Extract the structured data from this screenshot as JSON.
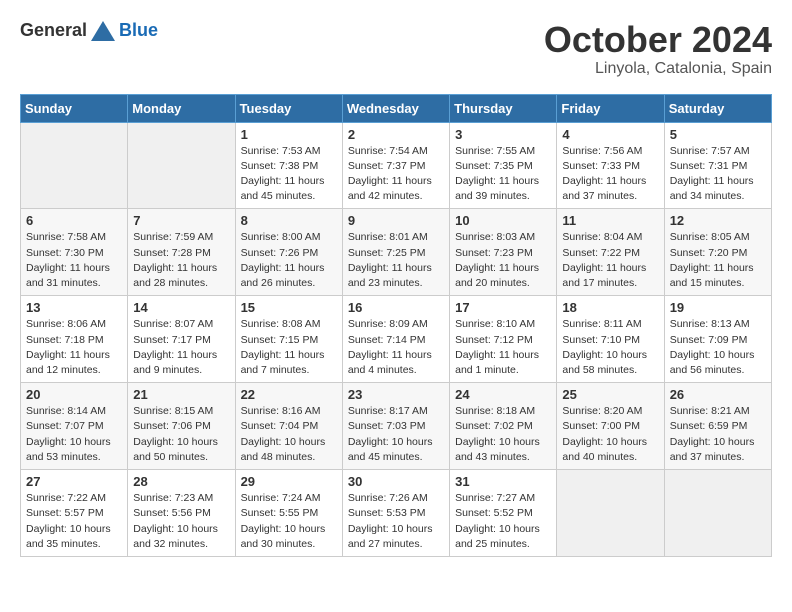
{
  "logo": {
    "general": "General",
    "blue": "Blue"
  },
  "header": {
    "month": "October 2024",
    "location": "Linyola, Catalonia, Spain"
  },
  "weekdays": [
    "Sunday",
    "Monday",
    "Tuesday",
    "Wednesday",
    "Thursday",
    "Friday",
    "Saturday"
  ],
  "weeks": [
    [
      {
        "day": "",
        "info": ""
      },
      {
        "day": "",
        "info": ""
      },
      {
        "day": "1",
        "info": "Sunrise: 7:53 AM\nSunset: 7:38 PM\nDaylight: 11 hours and 45 minutes."
      },
      {
        "day": "2",
        "info": "Sunrise: 7:54 AM\nSunset: 7:37 PM\nDaylight: 11 hours and 42 minutes."
      },
      {
        "day": "3",
        "info": "Sunrise: 7:55 AM\nSunset: 7:35 PM\nDaylight: 11 hours and 39 minutes."
      },
      {
        "day": "4",
        "info": "Sunrise: 7:56 AM\nSunset: 7:33 PM\nDaylight: 11 hours and 37 minutes."
      },
      {
        "day": "5",
        "info": "Sunrise: 7:57 AM\nSunset: 7:31 PM\nDaylight: 11 hours and 34 minutes."
      }
    ],
    [
      {
        "day": "6",
        "info": "Sunrise: 7:58 AM\nSunset: 7:30 PM\nDaylight: 11 hours and 31 minutes."
      },
      {
        "day": "7",
        "info": "Sunrise: 7:59 AM\nSunset: 7:28 PM\nDaylight: 11 hours and 28 minutes."
      },
      {
        "day": "8",
        "info": "Sunrise: 8:00 AM\nSunset: 7:26 PM\nDaylight: 11 hours and 26 minutes."
      },
      {
        "day": "9",
        "info": "Sunrise: 8:01 AM\nSunset: 7:25 PM\nDaylight: 11 hours and 23 minutes."
      },
      {
        "day": "10",
        "info": "Sunrise: 8:03 AM\nSunset: 7:23 PM\nDaylight: 11 hours and 20 minutes."
      },
      {
        "day": "11",
        "info": "Sunrise: 8:04 AM\nSunset: 7:22 PM\nDaylight: 11 hours and 17 minutes."
      },
      {
        "day": "12",
        "info": "Sunrise: 8:05 AM\nSunset: 7:20 PM\nDaylight: 11 hours and 15 minutes."
      }
    ],
    [
      {
        "day": "13",
        "info": "Sunrise: 8:06 AM\nSunset: 7:18 PM\nDaylight: 11 hours and 12 minutes."
      },
      {
        "day": "14",
        "info": "Sunrise: 8:07 AM\nSunset: 7:17 PM\nDaylight: 11 hours and 9 minutes."
      },
      {
        "day": "15",
        "info": "Sunrise: 8:08 AM\nSunset: 7:15 PM\nDaylight: 11 hours and 7 minutes."
      },
      {
        "day": "16",
        "info": "Sunrise: 8:09 AM\nSunset: 7:14 PM\nDaylight: 11 hours and 4 minutes."
      },
      {
        "day": "17",
        "info": "Sunrise: 8:10 AM\nSunset: 7:12 PM\nDaylight: 11 hours and 1 minute."
      },
      {
        "day": "18",
        "info": "Sunrise: 8:11 AM\nSunset: 7:10 PM\nDaylight: 10 hours and 58 minutes."
      },
      {
        "day": "19",
        "info": "Sunrise: 8:13 AM\nSunset: 7:09 PM\nDaylight: 10 hours and 56 minutes."
      }
    ],
    [
      {
        "day": "20",
        "info": "Sunrise: 8:14 AM\nSunset: 7:07 PM\nDaylight: 10 hours and 53 minutes."
      },
      {
        "day": "21",
        "info": "Sunrise: 8:15 AM\nSunset: 7:06 PM\nDaylight: 10 hours and 50 minutes."
      },
      {
        "day": "22",
        "info": "Sunrise: 8:16 AM\nSunset: 7:04 PM\nDaylight: 10 hours and 48 minutes."
      },
      {
        "day": "23",
        "info": "Sunrise: 8:17 AM\nSunset: 7:03 PM\nDaylight: 10 hours and 45 minutes."
      },
      {
        "day": "24",
        "info": "Sunrise: 8:18 AM\nSunset: 7:02 PM\nDaylight: 10 hours and 43 minutes."
      },
      {
        "day": "25",
        "info": "Sunrise: 8:20 AM\nSunset: 7:00 PM\nDaylight: 10 hours and 40 minutes."
      },
      {
        "day": "26",
        "info": "Sunrise: 8:21 AM\nSunset: 6:59 PM\nDaylight: 10 hours and 37 minutes."
      }
    ],
    [
      {
        "day": "27",
        "info": "Sunrise: 7:22 AM\nSunset: 5:57 PM\nDaylight: 10 hours and 35 minutes."
      },
      {
        "day": "28",
        "info": "Sunrise: 7:23 AM\nSunset: 5:56 PM\nDaylight: 10 hours and 32 minutes."
      },
      {
        "day": "29",
        "info": "Sunrise: 7:24 AM\nSunset: 5:55 PM\nDaylight: 10 hours and 30 minutes."
      },
      {
        "day": "30",
        "info": "Sunrise: 7:26 AM\nSunset: 5:53 PM\nDaylight: 10 hours and 27 minutes."
      },
      {
        "day": "31",
        "info": "Sunrise: 7:27 AM\nSunset: 5:52 PM\nDaylight: 10 hours and 25 minutes."
      },
      {
        "day": "",
        "info": ""
      },
      {
        "day": "",
        "info": ""
      }
    ]
  ]
}
